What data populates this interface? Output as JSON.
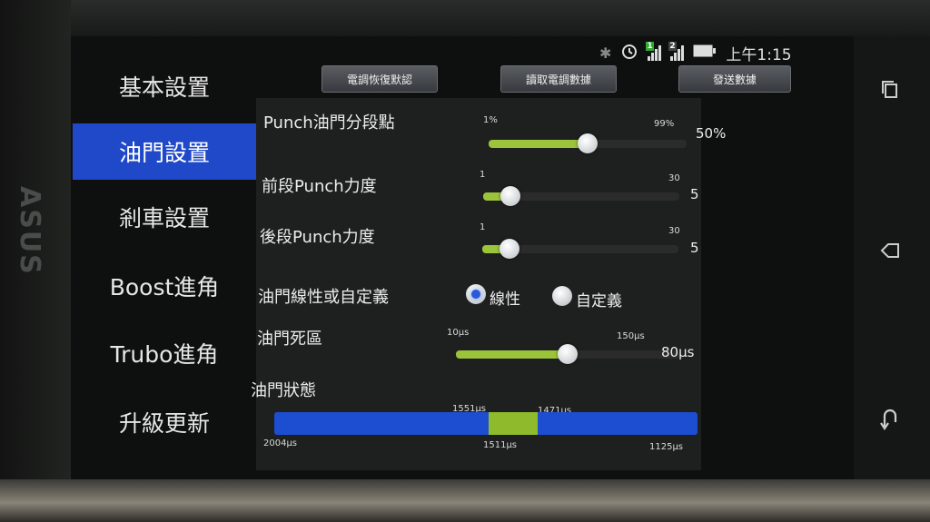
{
  "status": {
    "time": "上午1:15",
    "sim1": "1",
    "sim2": "2"
  },
  "sidebar": {
    "items": [
      {
        "label": "基本設置",
        "active": false
      },
      {
        "label": "油門設置",
        "active": true
      },
      {
        "label": "剎車設置",
        "active": false
      },
      {
        "label": "Boost進角",
        "active": false
      },
      {
        "label": "Trubo進角",
        "active": false
      },
      {
        "label": "升級更新",
        "active": false
      }
    ]
  },
  "toolbar": {
    "restore_label": "電調恢復默認",
    "read_label": "讀取電調數據",
    "send_label": "發送數據"
  },
  "settings": {
    "punch_split": {
      "label": "Punch油門分段點",
      "min": "1%",
      "max": "99%",
      "value": "50%",
      "fraction": 0.5
    },
    "front_punch": {
      "label": "前段Punch力度",
      "min": "1",
      "max": "30",
      "value": "5",
      "fraction": 0.14
    },
    "rear_punch": {
      "label": "後段Punch力度",
      "min": "1",
      "max": "30",
      "value": "5",
      "fraction": 0.14
    },
    "linearity": {
      "label": "油門線性或自定義",
      "option_linear": "線性",
      "option_custom": "自定義",
      "selected": "線性"
    },
    "deadband": {
      "label": "油門死區",
      "min": "10μs",
      "max": "150μs",
      "value": "80μs",
      "fraction": 0.5
    },
    "throttle_status": {
      "label": "油門狀態",
      "left": "2004μs",
      "center": "1511μs",
      "right": "1125μs",
      "seg_start": "1551μs",
      "seg_end": "1471μs"
    }
  },
  "colors": {
    "accent_blue": "#1f49c9",
    "slider_fill": "#9cc43a"
  }
}
